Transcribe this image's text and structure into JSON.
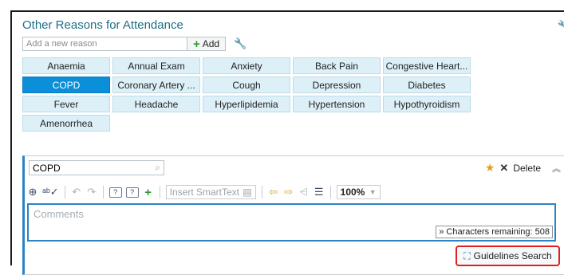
{
  "header": {
    "title": "Other Reasons for Attendance"
  },
  "add_row": {
    "placeholder": "Add a new reason",
    "add_label": "Add"
  },
  "reasons": [
    {
      "label": "Anaemia",
      "selected": false
    },
    {
      "label": "Annual Exam",
      "selected": false
    },
    {
      "label": "Anxiety",
      "selected": false
    },
    {
      "label": "Back Pain",
      "selected": false
    },
    {
      "label": "Congestive Heart...",
      "selected": false
    },
    {
      "label": "COPD",
      "selected": true
    },
    {
      "label": "Coronary Artery ...",
      "selected": false
    },
    {
      "label": "Cough",
      "selected": false
    },
    {
      "label": "Depression",
      "selected": false
    },
    {
      "label": "Diabetes",
      "selected": false
    },
    {
      "label": "Fever",
      "selected": false
    },
    {
      "label": "Headache",
      "selected": false
    },
    {
      "label": "Hyperlipidemia",
      "selected": false
    },
    {
      "label": "Hypertension",
      "selected": false
    },
    {
      "label": "Hypothyroidism",
      "selected": false
    },
    {
      "label": "Amenorrhea",
      "selected": false
    }
  ],
  "detail": {
    "search_value": "COPD",
    "delete_label": "Delete",
    "smarttext_placeholder": "Insert SmartText",
    "zoom": "100%",
    "comments_placeholder": "Comments",
    "chars_remaining": "» Characters remaining: 508",
    "guidelines_label": "Guidelines Search"
  },
  "colors": {
    "selected_chip": "#0a8fd8",
    "chip": "#ddf0f7",
    "highlight": "#e02020",
    "title": "#1f6f86"
  }
}
